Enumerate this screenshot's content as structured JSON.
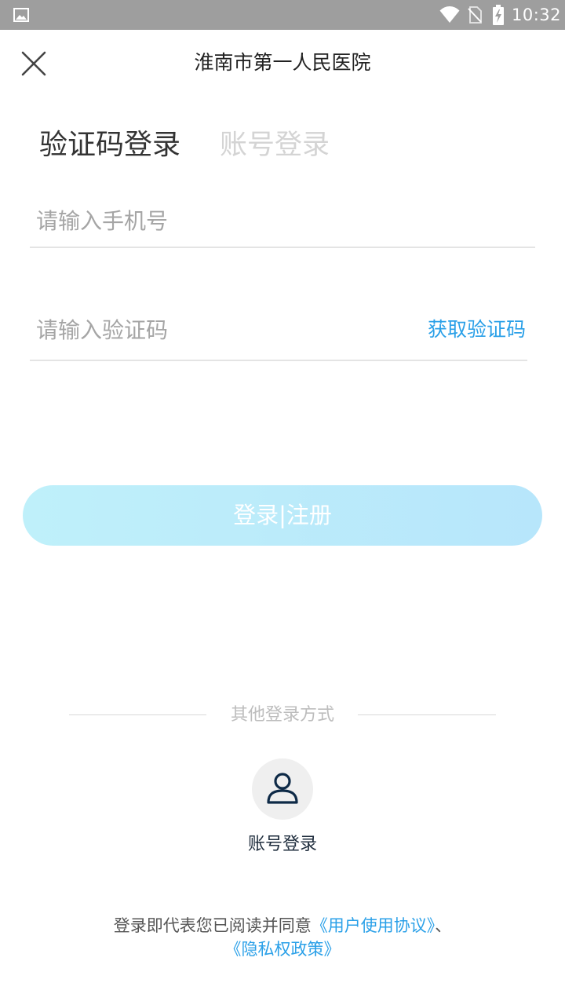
{
  "status_bar": {
    "time": "10:32",
    "icons": [
      "gallery-icon",
      "wifi-icon",
      "no-sim-icon",
      "battery-charging-icon"
    ]
  },
  "header": {
    "close_icon": "close-icon",
    "title": "淮南市第一人民医院"
  },
  "tabs": [
    {
      "label": "验证码登录",
      "active": true
    },
    {
      "label": "账号登录",
      "active": false
    }
  ],
  "form": {
    "phone_placeholder": "请输入手机号",
    "phone_value": "",
    "code_placeholder": "请输入验证码",
    "code_value": "",
    "get_code_label": "获取验证码"
  },
  "login_button": {
    "label": "登录|注册"
  },
  "other_login": {
    "label": "其他登录方式",
    "option_icon": "user-icon",
    "option_label": "账号登录"
  },
  "agreement": {
    "prefix": "登录即代表您已阅读并同意",
    "user_agreement": "《用户使用协议》",
    "separator": "、",
    "privacy_policy": "《隐私权政策》"
  },
  "colors": {
    "status_bar": "#9e9e9e",
    "accent": "#2aa0e8",
    "button_gradient_start": "#bff0fa",
    "button_gradient_end": "#b7e6fb",
    "inactive_tab": "#d4d4d4"
  }
}
